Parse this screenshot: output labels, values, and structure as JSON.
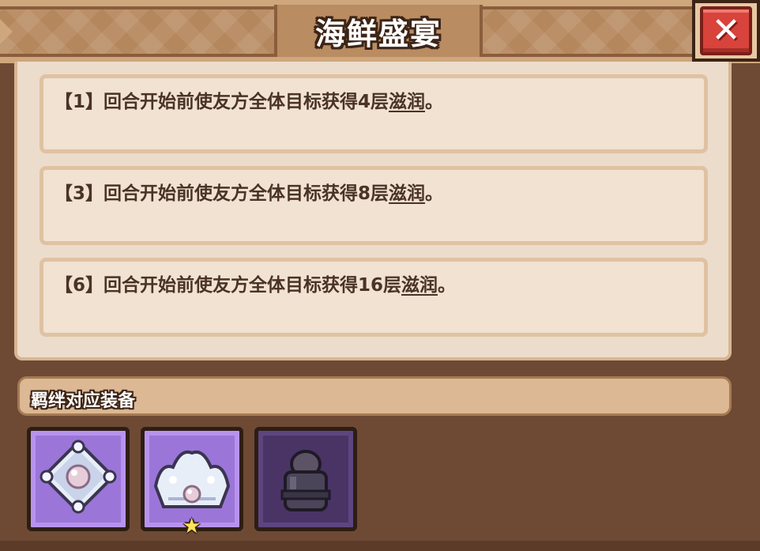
{
  "header": {
    "title": "海鲜盛宴",
    "close_icon": "✕"
  },
  "effects": [
    {
      "prefix": "【1】回合开始前使友方全体目标获得4层",
      "keyword": "滋润",
      "suffix": "。"
    },
    {
      "prefix": "【3】回合开始前使友方全体目标获得8层",
      "keyword": "滋润",
      "suffix": "。"
    },
    {
      "prefix": "【6】回合开始前使友方全体目标获得16层",
      "keyword": "滋润",
      "suffix": "。"
    }
  ],
  "equipment_section": {
    "title": "羁绊对应装备",
    "items": [
      {
        "icon": "pearl-brooch-icon",
        "rarity": "purple",
        "starred": false
      },
      {
        "icon": "pearl-crown-icon",
        "rarity": "purple",
        "starred": true,
        "star_glyph": "★"
      },
      {
        "icon": "dark-helmet-icon",
        "rarity": "dark",
        "starred": false
      }
    ]
  },
  "colors": {
    "background": "#6e4a35",
    "panel": "#ecdccb",
    "text": "#4a3326",
    "close_button": "#d8433c",
    "rare_slot": "#9b76d8"
  }
}
